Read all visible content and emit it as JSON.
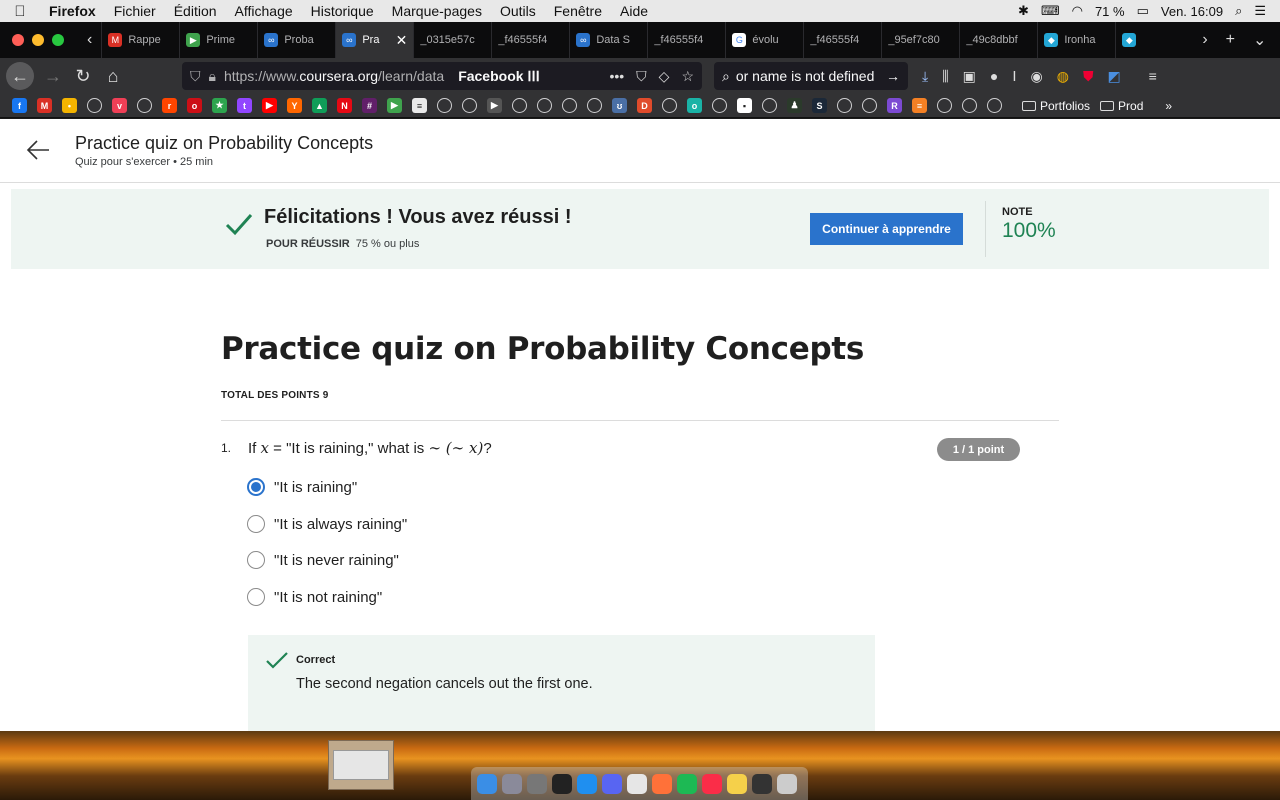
{
  "menubar": {
    "app": "Firefox",
    "items": [
      "Fichier",
      "Édition",
      "Affichage",
      "Historique",
      "Marque-pages",
      "Outils",
      "Fenêtre",
      "Aide"
    ],
    "battery": "71 %",
    "clock": "Ven. 16:09"
  },
  "tabs": [
    {
      "label": "Rappe",
      "color": "#d93025",
      "glyph": "M"
    },
    {
      "label": "Prime",
      "color": "#3fa34d",
      "glyph": "▶"
    },
    {
      "label": "Proba",
      "color": "#2a73cc",
      "glyph": "∞"
    },
    {
      "label": "Pra",
      "color": "#2a73cc",
      "glyph": "∞",
      "active": true
    },
    {
      "label": "_0315e57c",
      "color": "",
      "glyph": ""
    },
    {
      "label": "_f46555f4",
      "color": "",
      "glyph": ""
    },
    {
      "label": "Data S",
      "color": "#2a73cc",
      "glyph": "∞"
    },
    {
      "label": "_f46555f4",
      "color": "",
      "glyph": ""
    },
    {
      "label": "évolu",
      "color": "#ffffff",
      "glyph": "G"
    },
    {
      "label": "_f46555f4",
      "color": "",
      "glyph": ""
    },
    {
      "label": "_95ef7c80",
      "color": "",
      "glyph": ""
    },
    {
      "label": "_49c8dbbf",
      "color": "",
      "glyph": ""
    },
    {
      "label": "Ironha",
      "color": "#23a6d5",
      "glyph": "◆"
    },
    {
      "label": "",
      "color": "#23a6d5",
      "glyph": "◆"
    }
  ],
  "urlbar": {
    "url_prefix": "https://www.",
    "url_host": "coursera.org",
    "url_path": "/learn/data",
    "fb_label": "Facebook ⵏⵏⵏ",
    "search_text": "or name is not defined"
  },
  "bookmarks": {
    "icons": [
      {
        "name": "facebook",
        "color": "#1877f2",
        "glyph": "f"
      },
      {
        "name": "gmail",
        "color": "#d93025",
        "glyph": "M"
      },
      {
        "name": "keep",
        "color": "#f4b400",
        "glyph": "•"
      },
      {
        "name": "globe",
        "color": "",
        "glyph": ""
      },
      {
        "name": "pocket",
        "color": "#ef3f56",
        "glyph": "v"
      },
      {
        "name": "globe",
        "color": "",
        "glyph": ""
      },
      {
        "name": "reddit",
        "color": "#ff4500",
        "glyph": "r"
      },
      {
        "name": "opera",
        "color": "#cc0f16",
        "glyph": "o"
      },
      {
        "name": "star",
        "color": "#2da44e",
        "glyph": "★"
      },
      {
        "name": "twitch",
        "color": "#9146ff",
        "glyph": "t"
      },
      {
        "name": "youtube",
        "color": "#ff0000",
        "glyph": "▶"
      },
      {
        "name": "ycombinator",
        "color": "#ff6600",
        "glyph": "Y"
      },
      {
        "name": "drive",
        "color": "#0f9d58",
        "glyph": "▲"
      },
      {
        "name": "netflix",
        "color": "#e50914",
        "glyph": "N"
      },
      {
        "name": "slack",
        "color": "#611f69",
        "glyph": "#"
      },
      {
        "name": "play",
        "color": "#3fa34d",
        "glyph": "▶"
      },
      {
        "name": "news",
        "color": "#eaeaea",
        "glyph": "≡"
      },
      {
        "name": "globe",
        "color": "",
        "glyph": ""
      },
      {
        "name": "globe",
        "color": "",
        "glyph": ""
      },
      {
        "name": "play-grey",
        "color": "#555",
        "glyph": "▶"
      },
      {
        "name": "globe",
        "color": "",
        "glyph": ""
      },
      {
        "name": "globe",
        "color": "",
        "glyph": ""
      },
      {
        "name": "globe",
        "color": "",
        "glyph": ""
      },
      {
        "name": "globe",
        "color": "",
        "glyph": ""
      },
      {
        "name": "graph",
        "color": "#4a6fa5",
        "glyph": "ʊ"
      },
      {
        "name": "d-app",
        "color": "#e04b2b",
        "glyph": "D"
      },
      {
        "name": "globe",
        "color": "",
        "glyph": ""
      },
      {
        "name": "leetcode",
        "color": "#1ab3a6",
        "glyph": "o"
      },
      {
        "name": "globe",
        "color": "",
        "glyph": ""
      },
      {
        "name": "framework",
        "color": "#ffffff",
        "glyph": "▪"
      },
      {
        "name": "globe",
        "color": "",
        "glyph": ""
      },
      {
        "name": "steam-pic",
        "color": "#2b3a2b",
        "glyph": "♟"
      },
      {
        "name": "steam",
        "color": "#1b2838",
        "glyph": "S"
      },
      {
        "name": "globe",
        "color": "",
        "glyph": ""
      },
      {
        "name": "globe",
        "color": "",
        "glyph": ""
      },
      {
        "name": "r-lang",
        "color": "#7c4ad3",
        "glyph": "R"
      },
      {
        "name": "stack",
        "color": "#f48024",
        "glyph": "≡"
      },
      {
        "name": "globe",
        "color": "",
        "glyph": ""
      },
      {
        "name": "globe",
        "color": "",
        "glyph": ""
      },
      {
        "name": "globe",
        "color": "",
        "glyph": ""
      }
    ],
    "folders": [
      "Portfolios",
      "Prod"
    ]
  },
  "page": {
    "header_title": "Practice quiz on Probability Concepts",
    "header_sub": "Quiz pour s'exercer • 25  min",
    "banner": {
      "congrats": "Félicitations ! Vous avez réussi !",
      "pass_label": "POUR RÉUSSIR",
      "pass_value": "75 % ou plus",
      "continue_label": "Continuer à apprendre",
      "note_label": "NOTE",
      "note_value": "100%"
    },
    "quiz_title": "Practice quiz on Probability Concepts",
    "total_points": "TOTAL DES POINTS 9",
    "question": {
      "number": "1.",
      "text_before": "If ",
      "var1": "x",
      "eq": " = ",
      "text_mid": "\"It is raining,\" what is ",
      "neg_expr": "∼ (∼ x)",
      "text_after": "?",
      "score": "1 / 1 point",
      "options": [
        {
          "label": "\"It is raining\"",
          "selected": true
        },
        {
          "label": "\"It is always raining\"",
          "selected": false
        },
        {
          "label": "\"It is never raining\"",
          "selected": false
        },
        {
          "label": "\"It is not raining\"",
          "selected": false
        }
      ],
      "feedback_label": "Correct",
      "feedback_text": "The second negation cancels out the first one."
    }
  },
  "colors": {
    "accent": "#2a73cc",
    "success": "#1f8354",
    "banner_bg": "#eef5f2"
  }
}
